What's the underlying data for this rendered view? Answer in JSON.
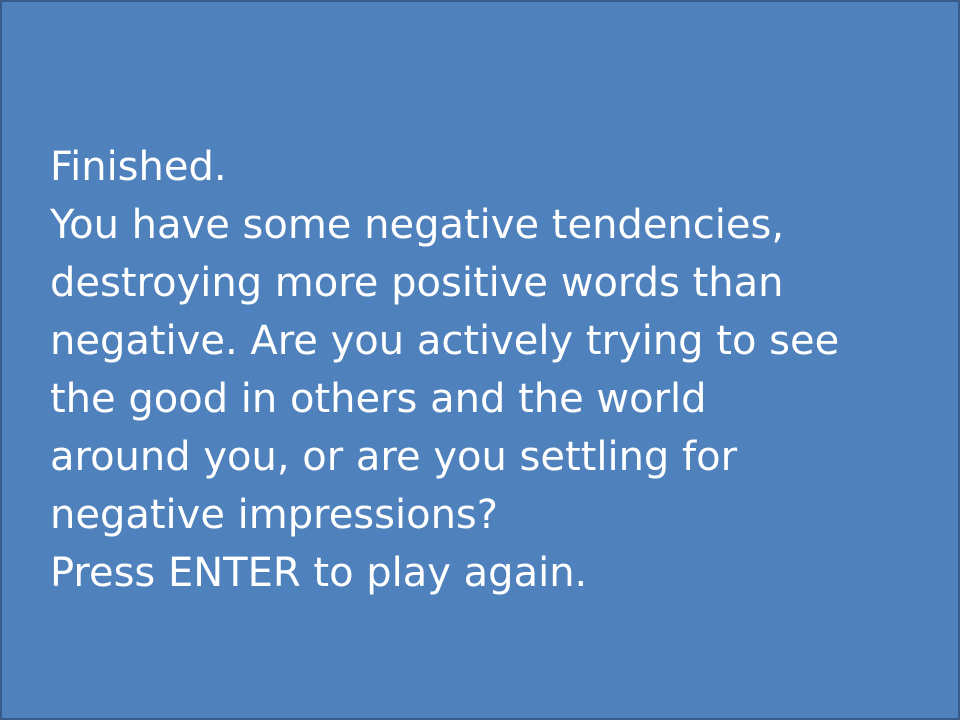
{
  "game_over_screen": {
    "title": "Finished.",
    "result_lines": [
      "You have some negative tendencies,",
      "destroying more positive words than",
      "negative. Are you actively trying to see",
      "the good in others and the world",
      "around you, or are you settling for",
      "negative impressions?"
    ],
    "prompt": "Press ENTER to play again.",
    "colors": {
      "background": "#4f81bd",
      "border": "#385d8a",
      "text": "#ffffff"
    }
  }
}
